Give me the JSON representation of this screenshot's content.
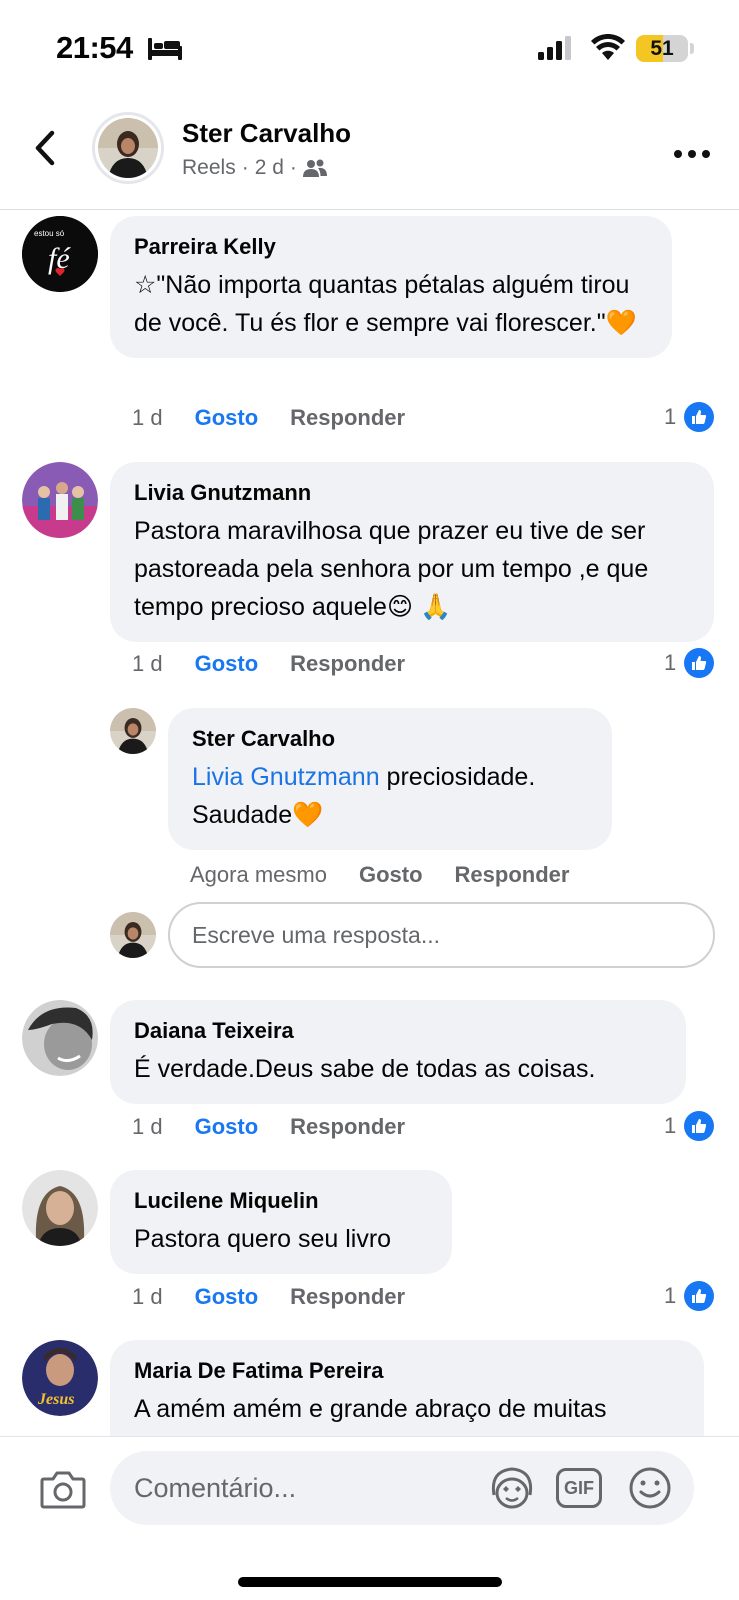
{
  "status_bar": {
    "time": "21:54",
    "battery": "51",
    "battery_level": 0.51
  },
  "header": {
    "name": "Ster Carvalho",
    "subtitle_type": "Reels",
    "separator": "·",
    "age": "2 d"
  },
  "comments": [
    {
      "author": "Parreira Kelly",
      "text": "☆\"Não importa quantas pétalas alguém tirou de você. Tu és flor e sempre vai florescer.\"🧡",
      "time": "1 d",
      "like_label": "Gosto",
      "reply_label": "Responder",
      "like_count": "1"
    },
    {
      "author": "Livia Gnutzmann",
      "text": "Pastora maravilhosa que prazer eu tive de ser pastoreada pela senhora por um tempo ,e que tempo precioso aquele😊 🙏",
      "time": "1 d",
      "like_label": "Gosto",
      "reply_label": "Responder",
      "like_count": "1",
      "reply": {
        "author": "Ster Carvalho",
        "mention": "Livia Gnutzmann",
        "text": " preciosidade. Saudade🧡",
        "time": "Agora mesmo",
        "like_label": "Gosto",
        "reply_label": "Responder"
      },
      "reply_placeholder": "Escreve uma resposta..."
    },
    {
      "author": "Daiana Teixeira",
      "text": "É verdade.Deus sabe de todas as coisas.",
      "time": "1 d",
      "like_label": "Gosto",
      "reply_label": "Responder",
      "like_count": "1"
    },
    {
      "author": "Lucilene Miquelin",
      "text": "Pastora quero seu livro",
      "time": "1 d",
      "like_label": "Gosto",
      "reply_label": "Responder",
      "like_count": "1"
    },
    {
      "author": "Maria De Fatima Pereira",
      "text": "A amém amém e grande abraço de muitas"
    }
  ],
  "avatar_texts": {
    "parreira": "estou só",
    "parreira_script": "fé",
    "maria": "Jesus"
  },
  "composer": {
    "placeholder": "Comentário...",
    "gif_label": "GIF"
  },
  "colors": {
    "accent": "#1877f2",
    "bubble": "#f0f2f5",
    "secondary_text": "#65676b"
  },
  "icons": [
    "bed-icon",
    "signal-icon",
    "wifi-icon",
    "back-icon",
    "more-icon",
    "friends-icon",
    "like-thumb-icon",
    "camera-icon",
    "avatar-sticker-icon",
    "gif-icon",
    "emoji-icon"
  ]
}
